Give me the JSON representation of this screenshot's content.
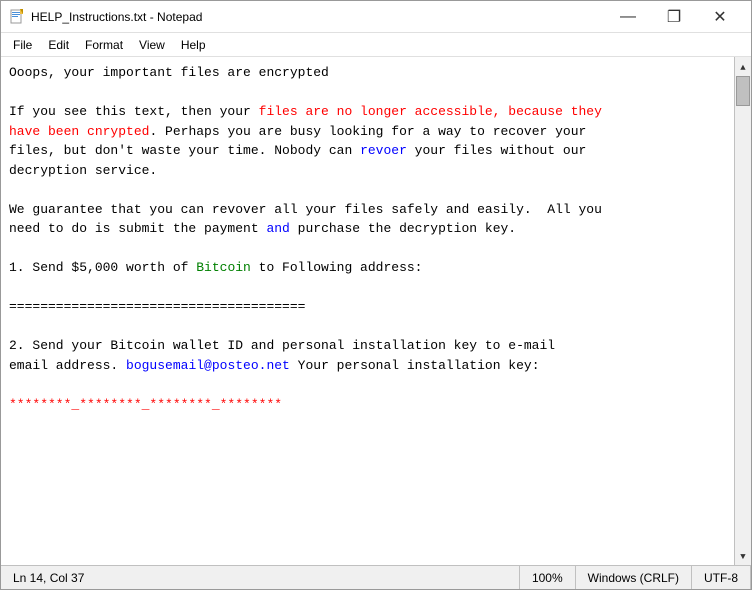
{
  "window": {
    "title": "HELP_Instructions.txt - Notepad"
  },
  "menu": {
    "items": [
      "File",
      "Edit",
      "Format",
      "View",
      "Help"
    ]
  },
  "content": {
    "line1": "Ooops, your important files are encrypted",
    "line2": "",
    "line3_part1": "If you see this text, then your files are no longer accessible, because they",
    "line3_part2": "have been cnrypted. Perhaps you are busy looking for a way to recover your",
    "line3_part3": "files, but don't waste your time. Nobody can revoer your files without our",
    "line3_part4": "decryption service.",
    "line4": "",
    "line5_part1": "We guarantee that you can revover all your files safely and easily.  All you",
    "line5_part2": "need to do is submit the payment",
    "line5_part3": "and",
    "line5_part4": "purchase the decryption key.",
    "line6": "",
    "line7": "1. Send $5,000 worth of Bitcoin to Following address:",
    "line8": "",
    "line9": "======================================",
    "line10": "",
    "line11_part1": "2. Send your Bitcoin wallet ID and personal installation key to e-mail",
    "line11_part2": "email address.",
    "line11_email": "bogusemail@posteo.net",
    "line11_part3": "Your personal installation key:",
    "line12": "",
    "line13": "********_********_********_********"
  },
  "status": {
    "position": "Ln 14, Col 37",
    "zoom": "100%",
    "line_ending": "Windows (CRLF)",
    "encoding": "UTF-8"
  },
  "title_controls": {
    "minimize": "—",
    "maximize": "❐",
    "close": "✕"
  }
}
